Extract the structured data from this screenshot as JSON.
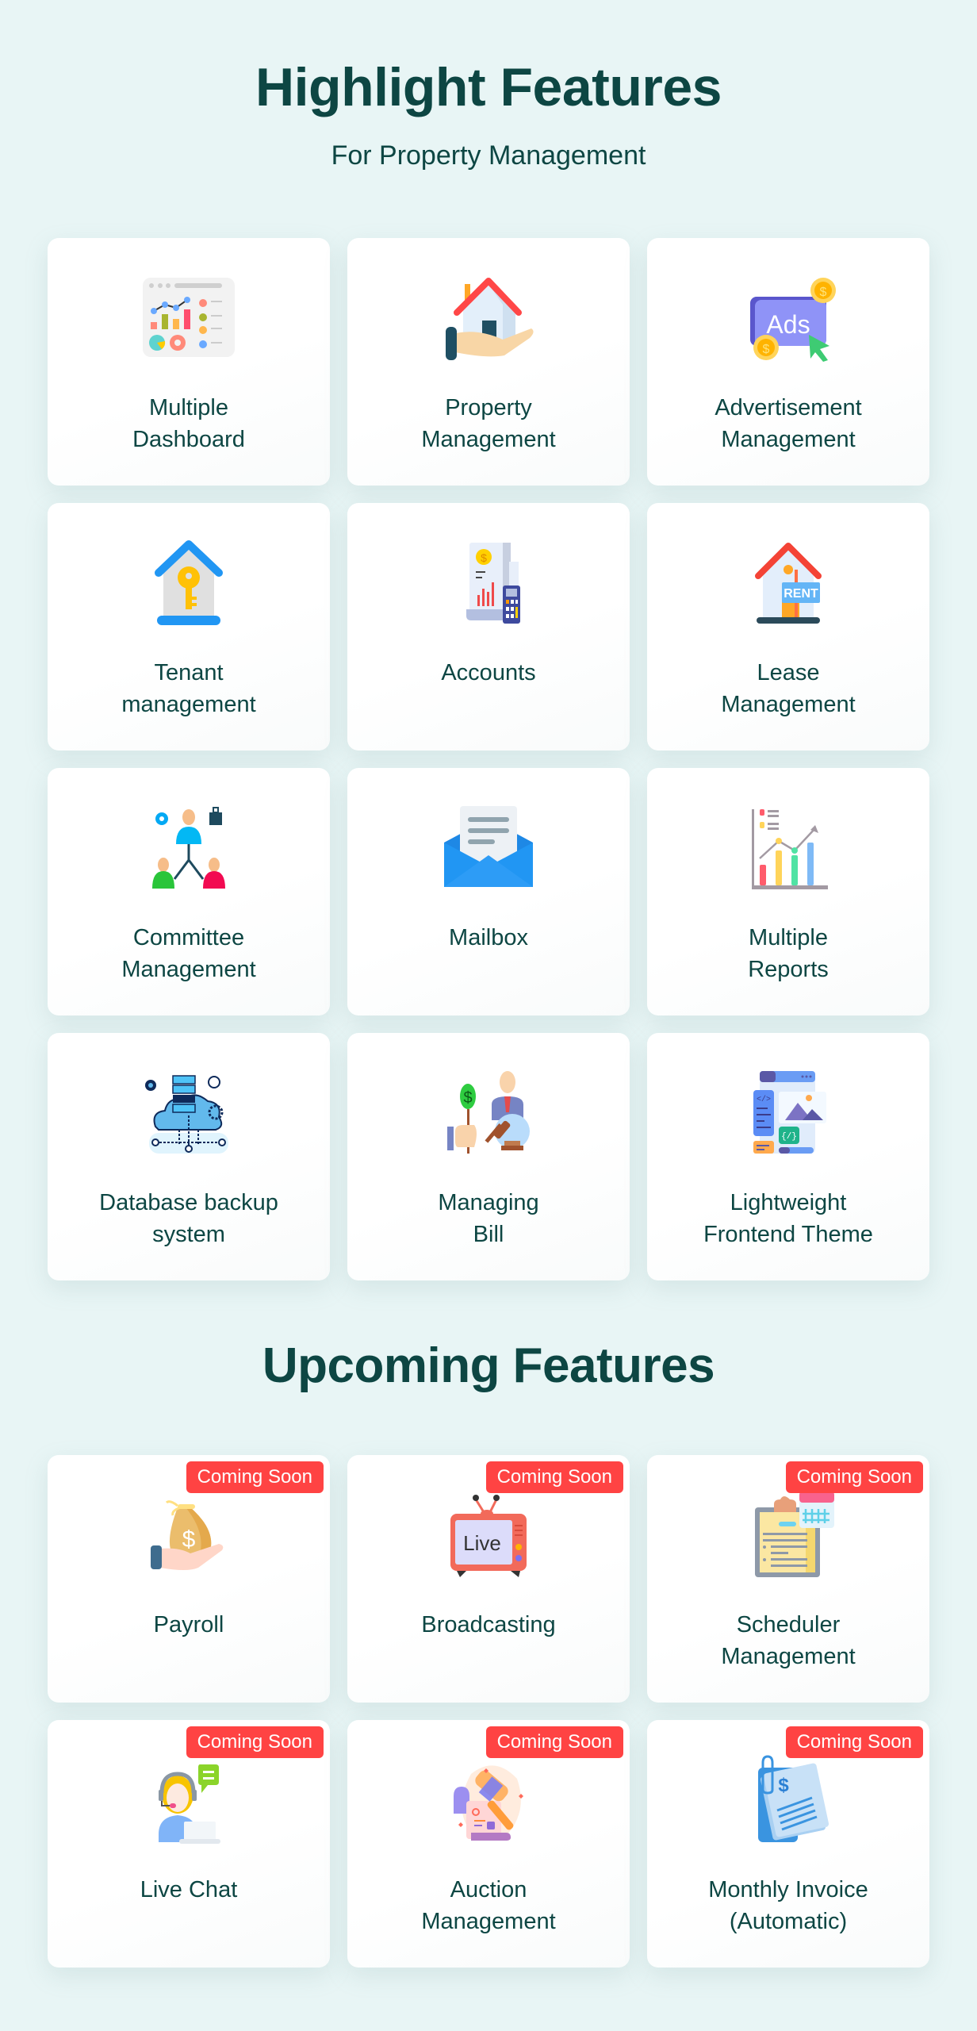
{
  "header": {
    "title": "Highlight Features",
    "subtitle": "For Property Management"
  },
  "highlight_features": [
    {
      "label": "Multiple\nDashboard",
      "icon": "dashboard-icon"
    },
    {
      "label": "Property\nManagement",
      "icon": "house-in-hand-icon"
    },
    {
      "label": "Advertisement\nManagement",
      "icon": "ads-icon"
    },
    {
      "label": "Tenant\nmanagement",
      "icon": "house-key-icon"
    },
    {
      "label": "Accounts",
      "icon": "accounts-calculator-icon"
    },
    {
      "label": "Lease\nManagement",
      "icon": "rent-house-icon"
    },
    {
      "label": "Committee\nManagement",
      "icon": "committee-icon"
    },
    {
      "label": "Mailbox",
      "icon": "mail-envelope-icon"
    },
    {
      "label": "Multiple\nReports",
      "icon": "reports-chart-icon"
    },
    {
      "label": "Database backup\nsystem",
      "icon": "cloud-database-icon"
    },
    {
      "label": "Managing\nBill",
      "icon": "bill-auction-icon"
    },
    {
      "label": "Lightweight\nFrontend Theme",
      "icon": "frontend-theme-icon"
    }
  ],
  "upcoming": {
    "title": "Upcoming Features",
    "badge_label": "Coming Soon",
    "badge_color": "#ff4343",
    "items": [
      {
        "label": "Payroll",
        "icon": "money-bag-hand-icon"
      },
      {
        "label": "Broadcasting",
        "icon": "live-tv-icon"
      },
      {
        "label": "Scheduler\nManagement",
        "icon": "clipboard-calendar-icon"
      },
      {
        "label": "Live Chat",
        "icon": "support-agent-icon"
      },
      {
        "label": "Auction\nManagement",
        "icon": "gavel-auction-icon"
      },
      {
        "label": "Monthly Invoice\n(Automatic)",
        "icon": "invoice-icon"
      }
    ]
  },
  "colors": {
    "background": "#e8f5f5",
    "text": "#0d4643",
    "card": "#ffffff"
  }
}
